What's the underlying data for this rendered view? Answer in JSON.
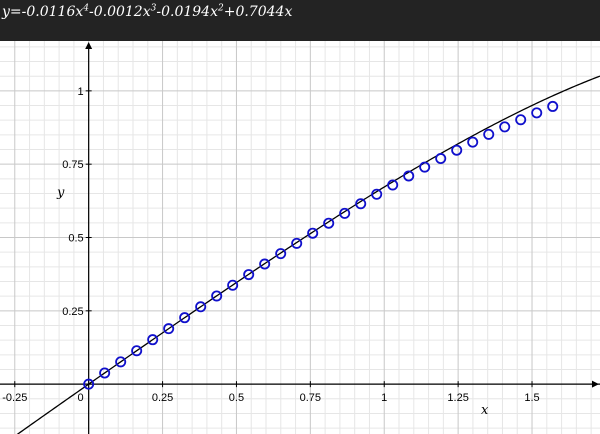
{
  "header": {
    "equation_prefix": "y=-0.0116",
    "equation_terms": [
      {
        "text": "x",
        "sup": "4",
        "after": "-0.0012"
      },
      {
        "text": "x",
        "sup": "3",
        "after": "-0.0194"
      },
      {
        "text": "x",
        "sup": "2",
        "after": "+0.7044"
      },
      {
        "text": "x",
        "sup": "",
        "after": ""
      }
    ]
  },
  "chart_data": {
    "type": "scatter",
    "xlabel": "x",
    "ylabel": "y",
    "xlim": [
      -0.3,
      1.73
    ],
    "ylim": [
      -0.17,
      1.17
    ],
    "x_ticks": [
      -0.25,
      0.25,
      0.5,
      0.75,
      1,
      1.25,
      1.5
    ],
    "x_tick_labels": [
      "-0.25",
      "0.25",
      "0.5",
      "0.75",
      "1",
      "1.25",
      "1.5"
    ],
    "origin_label": "0",
    "y_ticks": [
      0.25,
      0.5,
      0.75,
      1
    ],
    "y_tick_labels": [
      "0.25",
      "0.5",
      "0.75",
      "1"
    ],
    "grid": true,
    "minor_grid_step": 0.05,
    "major_grid_step": 0.25,
    "fit_coefficients": {
      "x4": -0.0116,
      "x3": -0.0012,
      "x2": -0.0194,
      "x1": 0.7044,
      "x0": 0
    },
    "points": [
      [
        0.0,
        0.0
      ],
      [
        0.0541,
        0.038
      ],
      [
        0.1083,
        0.076
      ],
      [
        0.1624,
        0.1139
      ],
      [
        0.2166,
        0.1516
      ],
      [
        0.2707,
        0.1892
      ],
      [
        0.3248,
        0.2266
      ],
      [
        0.379,
        0.2638
      ],
      [
        0.4331,
        0.3007
      ],
      [
        0.4872,
        0.3373
      ],
      [
        0.5414,
        0.3736
      ],
      [
        0.5955,
        0.4095
      ],
      [
        0.6497,
        0.445
      ],
      [
        0.7038,
        0.4801
      ],
      [
        0.7579,
        0.5147
      ],
      [
        0.8121,
        0.5488
      ],
      [
        0.8662,
        0.5823
      ],
      [
        0.9204,
        0.6152
      ],
      [
        0.9745,
        0.6475
      ],
      [
        1.0286,
        0.6791
      ],
      [
        1.0828,
        0.7099
      ],
      [
        1.1369,
        0.74
      ],
      [
        1.1911,
        0.7693
      ],
      [
        1.2452,
        0.7977
      ],
      [
        1.2993,
        0.8252
      ],
      [
        1.3535,
        0.8517
      ],
      [
        1.4076,
        0.8772
      ],
      [
        1.4617,
        0.9016
      ],
      [
        1.5159,
        0.9249
      ],
      [
        1.57,
        0.9469
      ]
    ],
    "colors": {
      "curve": "#000000",
      "marker": "#1010cc",
      "major_grid": "#c8c8c8",
      "minor_grid": "#e6e6e6",
      "axis": "#000000",
      "header_bg": "#232323"
    }
  }
}
